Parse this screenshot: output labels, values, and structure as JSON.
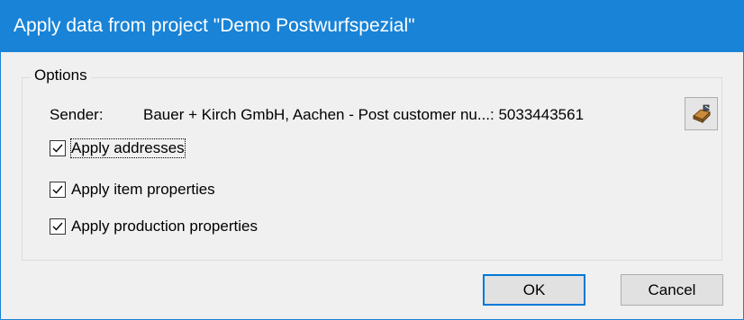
{
  "window": {
    "title": "Apply data from project \"Demo Postwurfspezial\"",
    "accent_color": "#1883d7"
  },
  "options": {
    "group_label": "Options",
    "sender_label": "Sender:",
    "sender_value": "Bauer + Kirch GmbH, Aachen - Post customer nu...: 5033443561",
    "sender_button_icon": "edit-sender-icon",
    "checkboxes": [
      {
        "label": "Apply addresses",
        "checked": true
      },
      {
        "label": "Apply item properties",
        "checked": true
      },
      {
        "label": "Apply production properties",
        "checked": true
      }
    ]
  },
  "buttons": {
    "ok": "OK",
    "cancel": "Cancel"
  }
}
